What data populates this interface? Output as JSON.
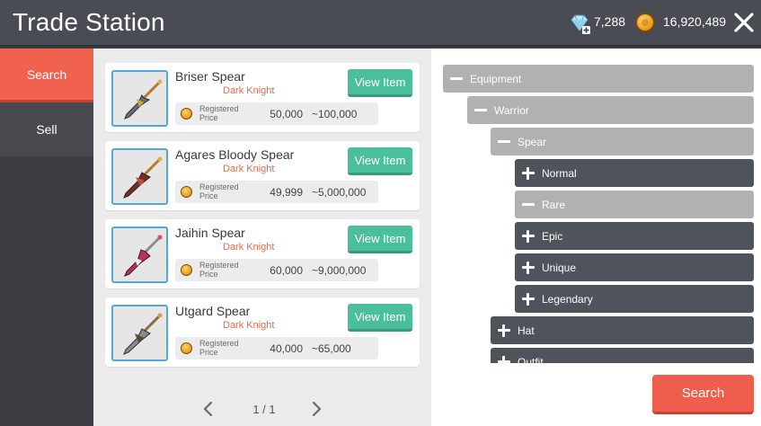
{
  "header": {
    "title": "Trade Station",
    "gems": "7,288",
    "gold": "16,920,489"
  },
  "sidebar": {
    "tabs": [
      {
        "label": "Search",
        "active": true
      },
      {
        "label": "Sell",
        "active": false
      }
    ]
  },
  "listings": [
    {
      "name": "Briser Spear",
      "class": "Dark Knight",
      "price_label": "Registered Price",
      "min_price": "50,000",
      "max_price": "~100,000",
      "button": "View Item"
    },
    {
      "name": "Agares Bloody Spear",
      "class": "Dark Knight",
      "price_label": "Registered Price",
      "min_price": "49,999",
      "max_price": "~5,000,000",
      "button": "View Item"
    },
    {
      "name": "Jaihin Spear",
      "class": "Dark Knight",
      "price_label": "Registered Price",
      "min_price": "60,000",
      "max_price": "~9,000,000",
      "button": "View Item"
    },
    {
      "name": "Utgard Spear",
      "class": "Dark Knight",
      "price_label": "Registered Price",
      "min_price": "40,000",
      "max_price": "~65,000",
      "button": "View Item"
    }
  ],
  "pagination": {
    "text": "1 / 1"
  },
  "category_tree": [
    {
      "label": "Equipment",
      "expanded": true
    },
    {
      "label": "Warrior",
      "expanded": true
    },
    {
      "label": "Spear",
      "expanded": true
    },
    {
      "label": "Normal",
      "expanded": false
    },
    {
      "label": "Rare",
      "expanded": true
    },
    {
      "label": "Epic",
      "expanded": false
    },
    {
      "label": "Unique",
      "expanded": false
    },
    {
      "label": "Legendary",
      "expanded": false
    },
    {
      "label": "Hat",
      "expanded": false
    },
    {
      "label": "Outfit",
      "expanded": false
    }
  ],
  "search_button": "Search",
  "colors": {
    "accent_red": "#f0624d",
    "view_button_green": "#4bbf9b",
    "class_text": "#e26b4a",
    "thumb_border": "#54a6d6",
    "node_open": "#b1b1b1",
    "node_closed": "#4e535c"
  },
  "icons": {
    "gem": "diamond-plus-icon",
    "gold": "gold-coin-icon",
    "close": "close-icon",
    "prev": "chevron-left-icon",
    "next": "chevron-right-icon"
  }
}
